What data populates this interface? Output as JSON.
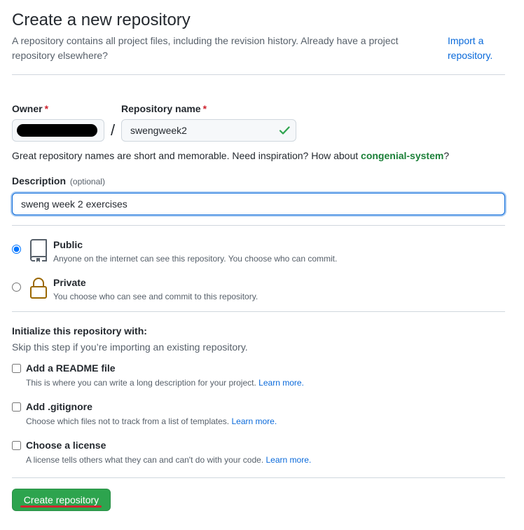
{
  "header": {
    "title": "Create a new repository",
    "description": "A repository contains all project files, including the revision history. Already have a project repository elsewhere?",
    "import_link": "Import a repository."
  },
  "form": {
    "owner_label": "Owner",
    "required_mark": "*",
    "slash": "/",
    "repo_label": "Repository name",
    "repo_value": "swengweek2",
    "hint_prefix": "Great repository names are short and memorable. Need inspiration? How about ",
    "hint_suggestion": "congenial-system",
    "hint_suffix": "?",
    "description_label": "Description",
    "description_optional": "(optional)",
    "description_value": "sweng week 2 exercises"
  },
  "visibility": {
    "options": [
      {
        "title": "Public",
        "subtitle": "Anyone on the internet can see this repository. You choose who can commit.",
        "selected": true,
        "icon": "repo-book-icon"
      },
      {
        "title": "Private",
        "subtitle": "You choose who can see and commit to this repository.",
        "selected": false,
        "icon": "lock-icon"
      }
    ]
  },
  "init": {
    "title": "Initialize this repository with:",
    "subtitle": "Skip this step if you’re importing an existing repository.",
    "learn_more": "Learn more.",
    "options": [
      {
        "title": "Add a README file",
        "subtitle": "This is where you can write a long description for your project.",
        "checked": false
      },
      {
        "title": "Add .gitignore",
        "subtitle": "Choose which files not to track from a list of templates.",
        "checked": false
      },
      {
        "title": "Choose a license",
        "subtitle": "A license tells others what they can and can't do with your code.",
        "checked": false
      }
    ]
  },
  "submit": {
    "label": "Create repository"
  },
  "colors": {
    "primary_green": "#2da44e",
    "link_blue": "#0969da",
    "suggestion_green": "#1a7f37",
    "required_red": "#cf222e",
    "private_icon": "#9a6700",
    "annotation_red": "#d1242f"
  }
}
